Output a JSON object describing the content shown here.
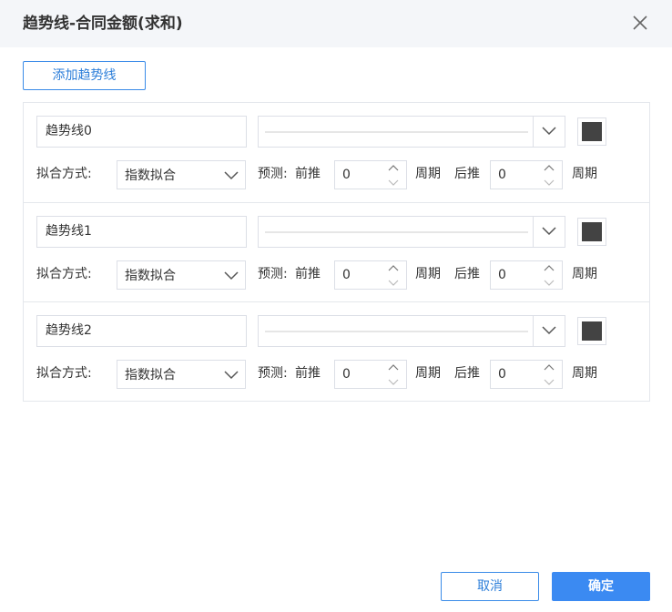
{
  "dialog": {
    "title": "趋势线-合同金额(求和)",
    "close_icon": "close-icon"
  },
  "toolbar": {
    "add_label": "添加趋势线"
  },
  "trendlines": [
    {
      "name": "趋势线0",
      "line_style": "solid",
      "color": "#434343",
      "fit_label": "拟合方式:",
      "fit_method": "指数拟合",
      "forecast_label": "预测:",
      "forward_label": "前推",
      "forward_value": "0",
      "forward_unit": "周期",
      "backward_label": "后推",
      "backward_value": "0",
      "backward_unit": "周期"
    },
    {
      "name": "趋势线1",
      "line_style": "solid",
      "color": "#434343",
      "fit_label": "拟合方式:",
      "fit_method": "指数拟合",
      "forecast_label": "预测:",
      "forward_label": "前推",
      "forward_value": "0",
      "forward_unit": "周期",
      "backward_label": "后推",
      "backward_value": "0",
      "backward_unit": "周期"
    },
    {
      "name": "趋势线2",
      "line_style": "solid",
      "color": "#434343",
      "fit_label": "拟合方式:",
      "fit_method": "指数拟合",
      "forecast_label": "预测:",
      "forward_label": "前推",
      "forward_value": "0",
      "forward_unit": "周期",
      "backward_label": "后推",
      "backward_value": "0",
      "backward_unit": "周期"
    }
  ],
  "footer": {
    "cancel_label": "取消",
    "ok_label": "确定"
  },
  "colors": {
    "accent": "#3b8af2",
    "border": "#dcdfe6",
    "header_bg": "#f4f6f9"
  }
}
